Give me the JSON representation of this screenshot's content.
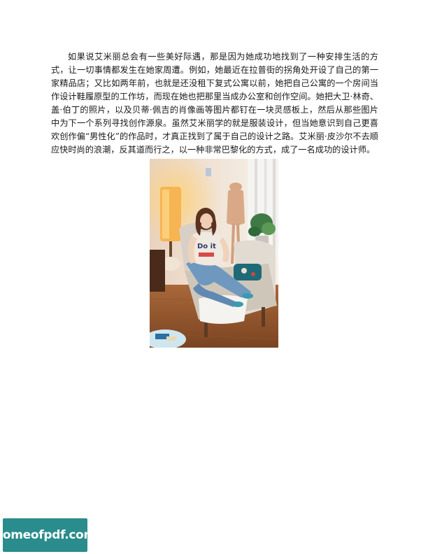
{
  "document": {
    "paragraph": "如果说艾米丽总会有一些美好际遇，那是因为她成功地找到了一种安排生活的方式，让一切事情都发生在她家周遭。例如，她最近在拉普街的拐角处开设了自己的第一家精品店；又比如两年前，也就是还没租下复式公寓以前，她把自己公寓的一个房间当作设计鞋履原型的工作坊，而现在她也把那里当成办公室和创作空间。她把大卫·林奇、盖·伯丁的照片，以及贝蒂·佩吉的肖像画等图片都钉在一块灵感板上，然后从那些图片中为下一个系列寻找创作源泉。虽然艾米丽学的就是服装设计，但当她意识到自己更喜欢创作偏“男性化”的作品时，才真正找到了属于自己的设计之路。艾米丽·皮沙尔不去顺应快时尚的浪潮，反其道而行之，以一种非常巴黎化的方式，成了一名成功的设计师。"
  },
  "photo": {
    "shirt_text": "Do it"
  },
  "watermark": {
    "text": "homeofpdf.com",
    "color": "#2a8c8c"
  }
}
